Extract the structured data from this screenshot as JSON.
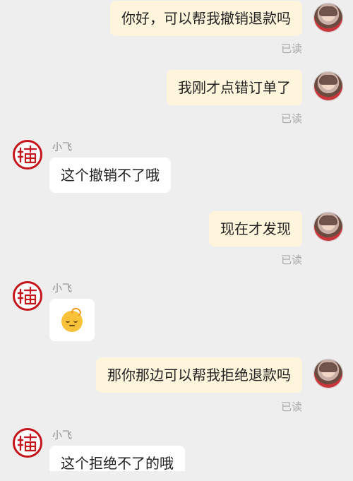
{
  "conversation": {
    "messages": [
      {
        "side": "out",
        "text": "你好，可以帮我撤销退款吗",
        "receipt": "已读"
      },
      {
        "side": "out",
        "text": "我刚才点错订单了",
        "receipt": "已读"
      },
      {
        "side": "in",
        "sender": "小飞",
        "text": "这个撤销不了哦"
      },
      {
        "side": "out",
        "text": "现在才发现",
        "receipt": "已读"
      },
      {
        "side": "in",
        "sender": "小飞",
        "emoji": "sleepy-face-emoji"
      },
      {
        "side": "out",
        "text": "那你那边可以帮我拒绝退款吗",
        "receipt": "已读"
      },
      {
        "side": "in",
        "sender": "小飞",
        "text": "这个拒绝不了的哦"
      }
    ]
  },
  "colors": {
    "background": "#eeeeee",
    "outgoing_bubble": "#fff5dd",
    "incoming_bubble": "#ffffff",
    "shop_avatar_red": "#c4161c",
    "receipt_text": "#a6a6a6"
  }
}
